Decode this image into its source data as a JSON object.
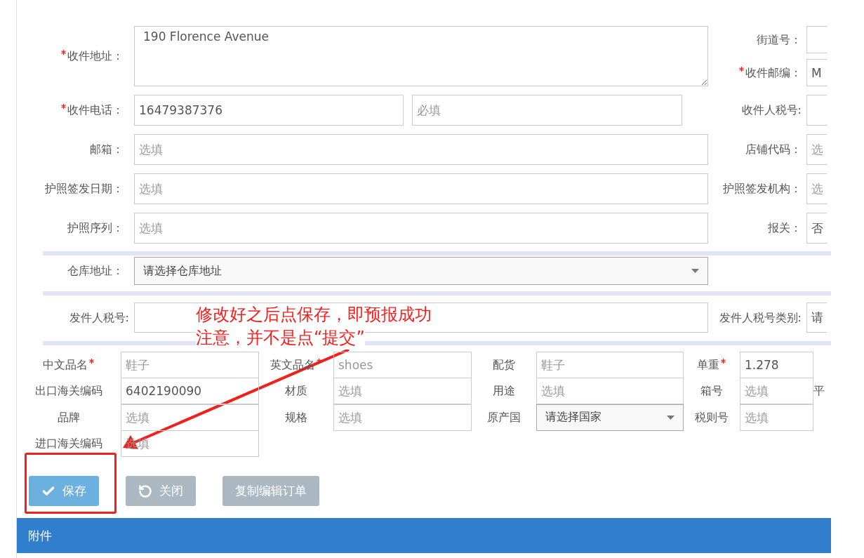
{
  "recipient_rows": [
    {
      "left": {
        "kind": "textarea",
        "label": "收件地址：",
        "required": true,
        "value": "190 Florence Avenue"
      },
      "right": [
        {
          "label": "街道号：",
          "required": false
        },
        {
          "label": "收件邮编：",
          "required": true,
          "value": "M"
        }
      ]
    },
    {
      "left": {
        "kind": "split",
        "label": "收件电话：",
        "required": true,
        "value": "16479387376",
        "second_placeholder": "必填"
      },
      "right": [
        {
          "label": "收件人税号:",
          "required": false
        }
      ]
    },
    {
      "left": {
        "kind": "text",
        "label": "邮箱：",
        "required": false,
        "placeholder": "选填"
      },
      "right": [
        {
          "label": "店铺代码：",
          "required": false,
          "placeholder": "选"
        }
      ]
    },
    {
      "left": {
        "kind": "text",
        "label": "护照签发日期：",
        "required": false,
        "placeholder": "选填"
      },
      "right": [
        {
          "label": "护照签发机构：",
          "required": false,
          "placeholder": "选"
        }
      ]
    },
    {
      "left": {
        "kind": "text",
        "label": "护照序列：",
        "required": false,
        "placeholder": "选填"
      },
      "right": [
        {
          "label": "报关：",
          "required": false,
          "value": "否"
        }
      ]
    }
  ],
  "warehouse": {
    "label": "仓库地址：",
    "value": "请选择仓库地址"
  },
  "sender_tax": {
    "left": {
      "label": "发件人税号:"
    },
    "right": {
      "label": "发件人税号类别:",
      "value": "请"
    }
  },
  "product_rows": [
    [
      {
        "label": "中文品名",
        "required": true,
        "kind": "text",
        "placeholder": "鞋子"
      },
      {
        "label": "英文品名",
        "required": true,
        "kind": "text",
        "placeholder": "shoes"
      },
      {
        "label": "配货",
        "required": false,
        "kind": "text",
        "placeholder": "鞋子"
      },
      {
        "label": "单重",
        "required": true,
        "kind": "text",
        "value": "1.278"
      }
    ],
    [
      {
        "label": "出口海关编码",
        "required": false,
        "kind": "text",
        "value": "6402190090"
      },
      {
        "label": "材质",
        "required": false,
        "kind": "text",
        "placeholder": "选填"
      },
      {
        "label": "用途",
        "required": false,
        "kind": "text",
        "placeholder": "选填"
      },
      {
        "label": "箱号",
        "required": false,
        "kind": "text",
        "placeholder": "选填"
      },
      {
        "label": "平",
        "required": false,
        "kind": "label"
      }
    ],
    [
      {
        "label": "品牌",
        "required": false,
        "kind": "text",
        "placeholder": "选填"
      },
      {
        "label": "规格",
        "required": false,
        "kind": "text",
        "placeholder": "选填"
      },
      {
        "label": "原产国",
        "required": false,
        "kind": "select",
        "value": "请选择国家"
      },
      {
        "label": "税则号",
        "required": false,
        "kind": "text",
        "placeholder": "选填"
      }
    ],
    [
      {
        "label": "进口海关编码",
        "required": false,
        "kind": "text",
        "placeholder": "选填"
      }
    ]
  ],
  "buttons": [
    {
      "label": "保存",
      "kind": "save"
    },
    {
      "label": "关闭",
      "kind": "close"
    },
    {
      "label": "复制编辑订单",
      "kind": "copy"
    }
  ],
  "section_bar": {
    "title": "附件"
  },
  "annotation": {
    "lines": [
      "修改好之后点保存，即预报成功",
      "注意，并不是点“提交”"
    ]
  }
}
